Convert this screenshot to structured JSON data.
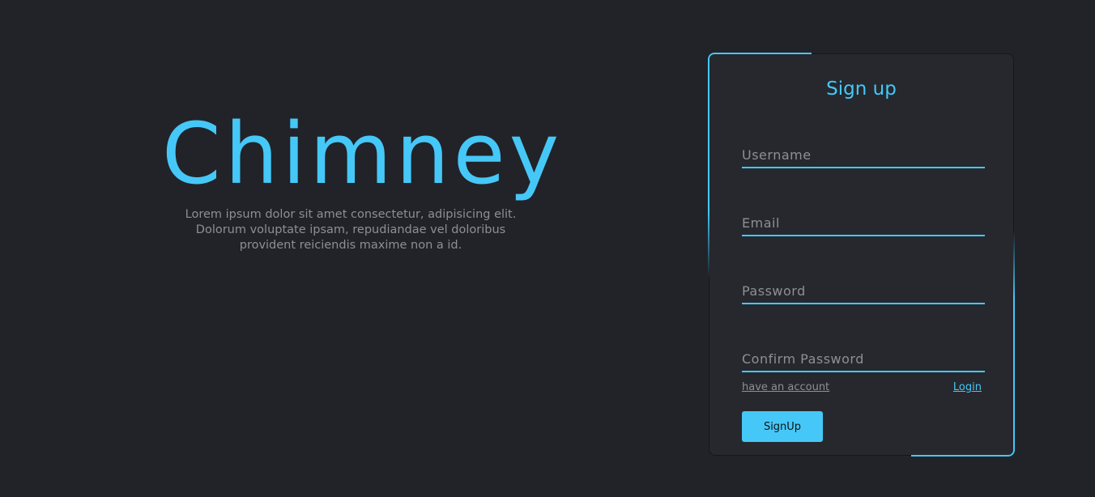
{
  "brand": {
    "title": "Chimney",
    "description": "Lorem ipsum dolor sit amet consectetur, adipisicing elit. Dolorum voluptate ipsam, repudiandae vel doloribus provident reiciendis maxime non a id."
  },
  "signup_form": {
    "title": "Sign up",
    "fields": {
      "username": {
        "placeholder": "Username",
        "value": ""
      },
      "email": {
        "placeholder": "Email",
        "value": ""
      },
      "password": {
        "placeholder": "Password",
        "value": ""
      },
      "confirm_password": {
        "placeholder": "Confirm Password",
        "value": ""
      }
    },
    "have_account_label": "have an account",
    "login_label": "Login",
    "submit_label": "SignUp"
  },
  "colors": {
    "background": "#212329",
    "card_background": "#26282e",
    "accent": "#45c8f7",
    "muted_text": "#8d8f94"
  }
}
